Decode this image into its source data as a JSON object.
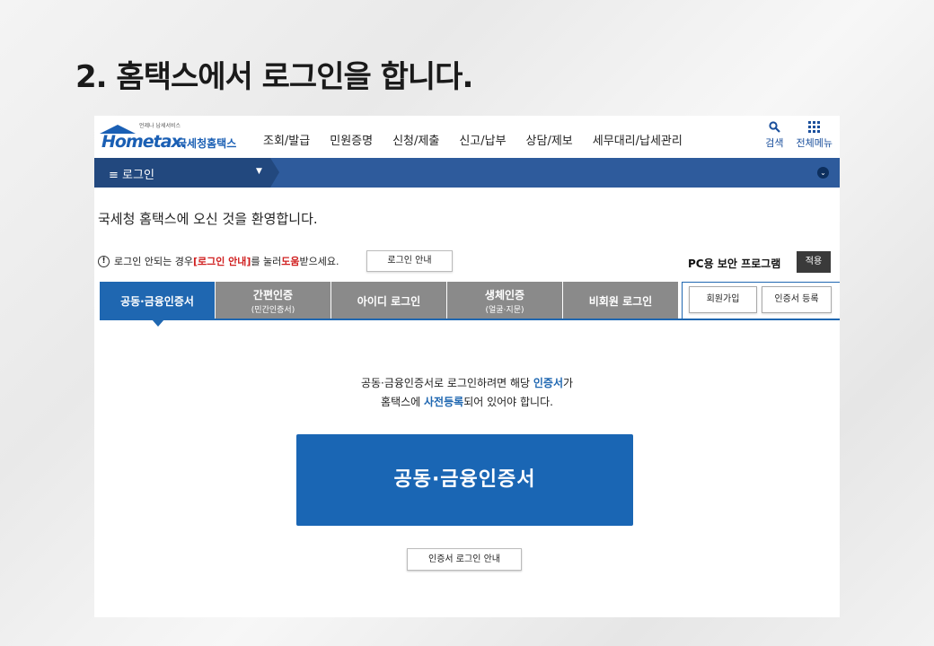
{
  "slide": {
    "title": "2. 홈택스에서 로그인을 합니다."
  },
  "header": {
    "logo_small": "언제나 납세서비스",
    "logo_text": "Hometax.",
    "logo_name": "국세청홈택스",
    "nav": [
      "조회/발급",
      "민원증명",
      "신청/제출",
      "신고/납부",
      "상담/제보",
      "세무대리/납세관리"
    ],
    "search_label": "검색",
    "menu_label": "전체메뉴"
  },
  "breadcrumb": {
    "menu_label": "≡  로그인"
  },
  "main": {
    "welcome": "국세청 홈택스에 오신 것을 환영합니다.",
    "notice_prefix": "로그인 안되는 경우 ",
    "notice_red": "[로그인 안내]",
    "notice_mid": "를 눌러 ",
    "notice_red2": "도움",
    "notice_suffix": "받으세요.",
    "guide_button": "로그인 안내",
    "pc_security_label": "PC용 보안 프로그램",
    "apply_button": "적용"
  },
  "tabs": [
    {
      "label": "공동·금융인증서",
      "sub": ""
    },
    {
      "label": "간편인증",
      "sub": "(민간인증서)"
    },
    {
      "label": "아이디 로그인",
      "sub": ""
    },
    {
      "label": "생체인증",
      "sub": "(얼굴·지문)"
    },
    {
      "label": "비회원 로그인",
      "sub": ""
    }
  ],
  "side_buttons": {
    "join": "회원가입",
    "register_cert": "인증서 등록"
  },
  "info": {
    "line1_a": "공동·금융인증서로 로그인하려면 해당 ",
    "line1_b": "인증서",
    "line1_c": "가",
    "line2_a": "홈택스에 ",
    "line2_b": "사전등록",
    "line2_c": "되어 있어야 합니다."
  },
  "login_button": "공동·금융인증서",
  "cert_guide_button": "인증서 로그인 안내"
}
